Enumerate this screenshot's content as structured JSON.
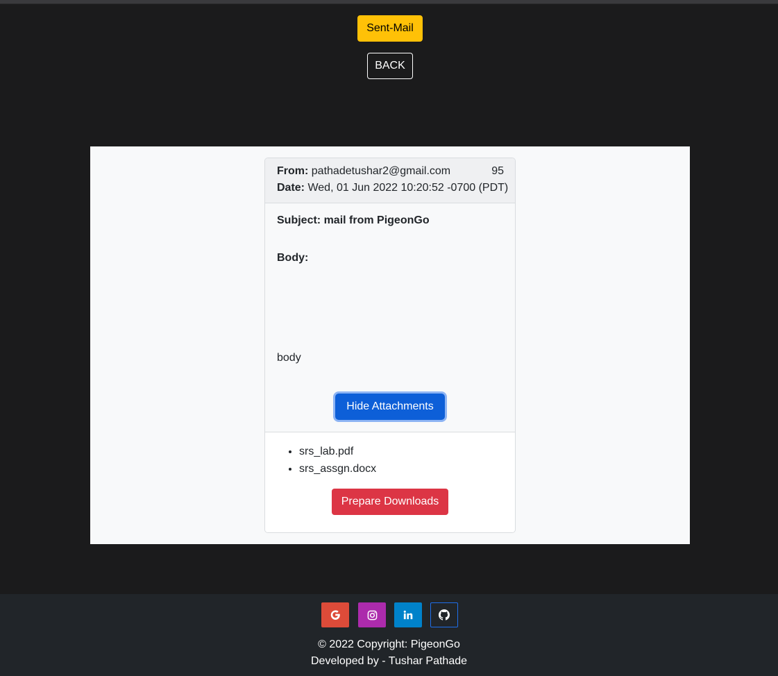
{
  "nav": {
    "sent_mail_label": "Sent-Mail",
    "back_label": "BACK"
  },
  "mail": {
    "from_label": "From:",
    "from_value": "pathadetushar2@gmail.com",
    "number": "95",
    "date_label": "Date:",
    "date_value": "Wed, 01 Jun 2022 10:20:52 -0700 (PDT)",
    "subject_label": "Subject:",
    "subject_value": "mail from PigeonGo",
    "body_label": "Body:",
    "body_value": "body",
    "hide_attachments_label": "Hide Attachments",
    "attachments": [
      "srs_lab.pdf",
      "srs_assgn.docx"
    ],
    "prepare_downloads_label": "Prepare Downloads"
  },
  "footer": {
    "social": [
      {
        "name": "google",
        "icon": "google-icon",
        "color": "#dd4b39"
      },
      {
        "name": "instagram",
        "icon": "instagram-icon",
        "color": "#ac2bac"
      },
      {
        "name": "linkedin",
        "icon": "linkedin-icon",
        "color": "#0082ca"
      },
      {
        "name": "github",
        "icon": "github-icon",
        "color": "#212529"
      }
    ],
    "copyright": "© 2022 Copyright: PigeonGo",
    "developed_by": "Developed by - Tushar Pathade"
  },
  "colors": {
    "page_bg": "#1b1b1c",
    "panel_bg": "#f8f9fa",
    "warning": "#ffc107",
    "primary": "#0d5fd8",
    "danger": "#dc3545",
    "footer_bg": "#212529"
  }
}
